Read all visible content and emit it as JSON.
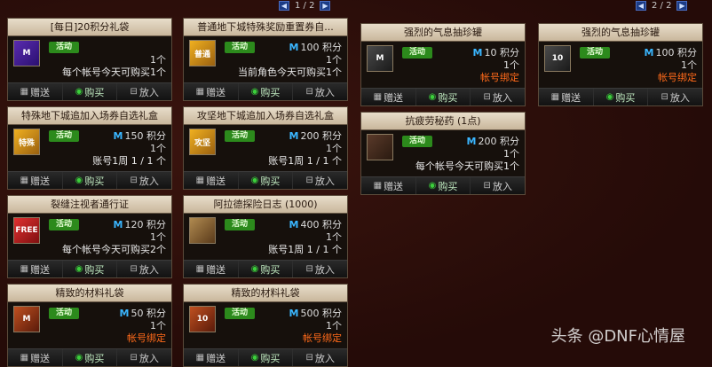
{
  "pager_left": {
    "text": "1 / 2"
  },
  "pager_right": {
    "text": "2 / 2"
  },
  "actions": {
    "gift": "赠送",
    "buy": "购买",
    "cart": "放入"
  },
  "badge_label": "活动",
  "currency_mark": "M",
  "cards": [
    {
      "title": "[每日]20积分礼袋",
      "icon": "gift-bag-icon",
      "icon_text": "M",
      "price": "",
      "qty": "1个",
      "limit": "每个帐号今天可购买1个",
      "bound": false
    },
    {
      "title": "普通地下城特殊奖励重置券自...",
      "icon": "ticket-chest-icon",
      "icon_text": "普通",
      "price": "100 积分",
      "qty": "1个",
      "limit": "当前角色今天可购买1个",
      "bound": false
    },
    {
      "title": "特殊地下城追加入场券自选礼盒",
      "icon": "gold-chest-icon",
      "icon_text": "特殊",
      "price": "150 积分",
      "qty": "1个",
      "limit": "账号1周 1 / 1 个",
      "bound": false
    },
    {
      "title": "攻坚地下城追加入场券自选礼盒",
      "icon": "gold-chest-icon",
      "icon_text": "攻坚",
      "price": "200 积分",
      "qty": "1个",
      "limit": "账号1周 1 / 1 个",
      "bound": false
    },
    {
      "title": "裂缝注视者通行证",
      "icon": "free-pass-icon",
      "icon_text": "FREE",
      "price": "120 积分",
      "qty": "1个",
      "limit": "每个帐号今天可购买2个",
      "bound": false
    },
    {
      "title": "阿拉德探险日志 (1000)",
      "icon": "scroll-icon",
      "icon_text": "",
      "price": "400 积分",
      "qty": "1个",
      "limit": "账号1周 1 / 1 个",
      "bound": false
    },
    {
      "title": "精致的材料礼袋",
      "icon": "material-bag-icon",
      "icon_text": "M",
      "price": "50 积分",
      "qty": "1个",
      "limit": "帐号绑定",
      "bound": true
    },
    {
      "title": "精致的材料礼袋",
      "icon": "material-bag-icon",
      "icon_text": "10",
      "price": "500 积分",
      "qty": "1个",
      "limit": "帐号绑定",
      "bound": true
    },
    {
      "title": "强烈的气息抽珍罐",
      "icon": "jar-icon",
      "icon_text": "M",
      "price": "10 积分",
      "qty": "1个",
      "limit": "帐号绑定",
      "bound": true
    },
    {
      "title": "强烈的气息抽珍罐",
      "icon": "jar-icon",
      "icon_text": "10",
      "price": "100 积分",
      "qty": "1个",
      "limit": "帐号绑定",
      "bound": true
    },
    {
      "title": "抗疲劳秘药 (1点)",
      "icon": "potion-icon",
      "icon_text": "",
      "price": "200 积分",
      "qty": "1个",
      "limit": "每个帐号今天可购买1个",
      "bound": false
    }
  ],
  "watermark": "头条 @DNF心情屋"
}
